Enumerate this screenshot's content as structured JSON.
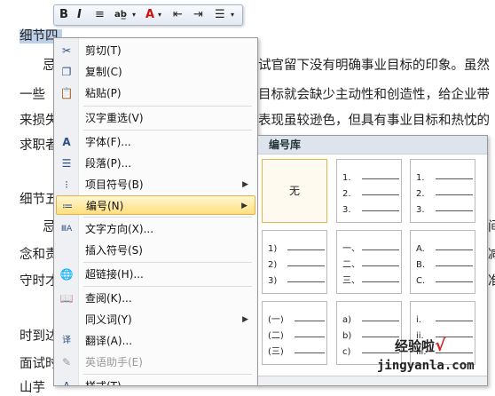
{
  "document": {
    "lines": [
      "细节四.",
      "忌",
      "试官留下没有明确事业目标的印象。虽然",
      "一些",
      "目标就会缺少主动性和创造性，给企业带",
      "来损失",
      "表现虽较逊色，但具有事业目标和热忱的",
      "求职者",
      "细节五",
      "忌",
      "间",
      "念和责",
      "减",
      "守时才",
      "准",
      "时到达",
      "面试时",
      "山芋"
    ]
  },
  "mini_toolbar": {
    "bold": "B",
    "italic": "I",
    "center": "≡",
    "highlight": "ab̲",
    "font_color": "A",
    "dec_indent": "⇤",
    "inc_indent": "⇥",
    "bullets": "☰"
  },
  "context_menu": {
    "items": [
      {
        "label": "剪切(T)",
        "icon": "scissors-icon",
        "glyph": "✂"
      },
      {
        "label": "复制(C)",
        "icon": "copy-icon",
        "glyph": "❐"
      },
      {
        "label": "粘贴(P)",
        "icon": "paste-icon",
        "glyph": "📋"
      },
      {
        "label": "汉字重选(V)",
        "icon": "",
        "glyph": ""
      },
      {
        "label": "字体(F)...",
        "icon": "font-icon",
        "glyph": "A"
      },
      {
        "label": "段落(P)...",
        "icon": "paragraph-icon",
        "glyph": "☰"
      },
      {
        "label": "项目符号(B)",
        "icon": "bullets-icon",
        "glyph": "⁝"
      },
      {
        "label": "编号(N)",
        "icon": "numbering-icon",
        "glyph": "≔"
      },
      {
        "label": "文字方向(X)...",
        "icon": "text-direction-icon",
        "glyph": "ⅢA"
      },
      {
        "label": "插入符号(S)",
        "icon": "",
        "glyph": ""
      },
      {
        "label": "超链接(H)...",
        "icon": "hyperlink-icon",
        "glyph": "🌐"
      },
      {
        "label": "查阅(K)...",
        "icon": "lookup-icon",
        "glyph": "📖"
      },
      {
        "label": "同义词(Y)",
        "icon": "",
        "glyph": ""
      },
      {
        "label": "翻译(A)...",
        "icon": "translate-icon",
        "glyph": "译"
      },
      {
        "label": "英语助手(E)",
        "icon": "english-assistant-icon",
        "glyph": "✎"
      },
      {
        "label": "样式(T)",
        "icon": "styles-icon",
        "glyph": "A"
      }
    ]
  },
  "numbering_library": {
    "title": "编号库",
    "none_label": "无",
    "cells": [
      [
        "1.",
        "2.",
        "3."
      ],
      [
        "1.",
        "2.",
        "3."
      ],
      [
        "1)",
        "2)",
        "3)"
      ],
      [
        "一、",
        "二、",
        "三、"
      ],
      [
        "A.",
        "B.",
        "C."
      ],
      [
        "(一)",
        "(二)",
        "(三)"
      ],
      [
        "a)",
        "b)",
        "c)"
      ],
      [
        "i.",
        "ii.",
        "iii."
      ]
    ]
  },
  "watermark": {
    "text": "经验啦",
    "check": "√",
    "url": "jingyanla.com"
  }
}
